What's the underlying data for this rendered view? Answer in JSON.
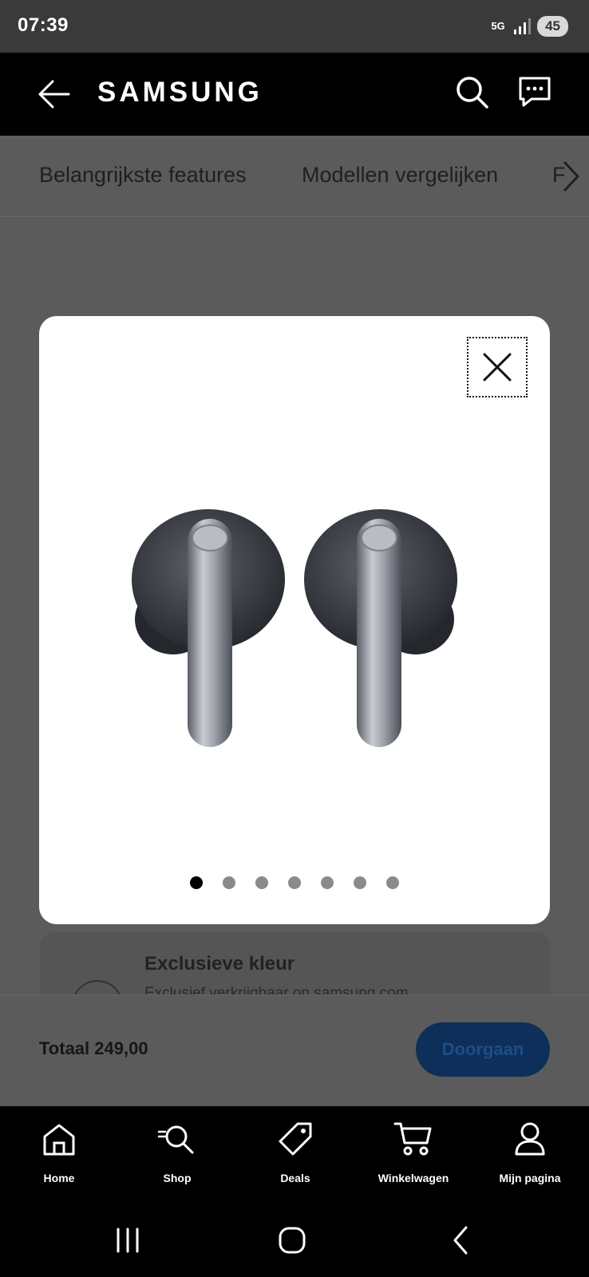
{
  "status_bar": {
    "time": "07:39",
    "network": "5G",
    "battery": "45"
  },
  "header": {
    "brand": "SAMSUNG",
    "icons": [
      "back-arrow-icon",
      "search-icon",
      "chat-icon"
    ]
  },
  "tabs": {
    "items": [
      "Belangrijkste features",
      "Modellen vergelijken",
      "F"
    ]
  },
  "modal": {
    "image_alt_icon": "earbuds-image",
    "slide_count": 7,
    "active_slide": 1
  },
  "behind_card": {
    "title": "Exclusieve kleur",
    "subtitle": "Exclusief verkrijgbaar op samsung.com"
  },
  "summary": {
    "total": "Totaal 249,00",
    "cta": "Doorgaan"
  },
  "bottom_nav": {
    "items": [
      {
        "label": "Home",
        "icon": "home-icon"
      },
      {
        "label": "Shop",
        "icon": "shop-search-icon"
      },
      {
        "label": "Deals",
        "icon": "tag-icon"
      },
      {
        "label": "Winkelwagen",
        "icon": "cart-icon"
      },
      {
        "label": "Mijn pagina",
        "icon": "person-icon"
      }
    ]
  },
  "colors": {
    "cta_bg": "#0d2f5a",
    "overlay": "#5b5b5b",
    "header_bg": "#000000"
  }
}
